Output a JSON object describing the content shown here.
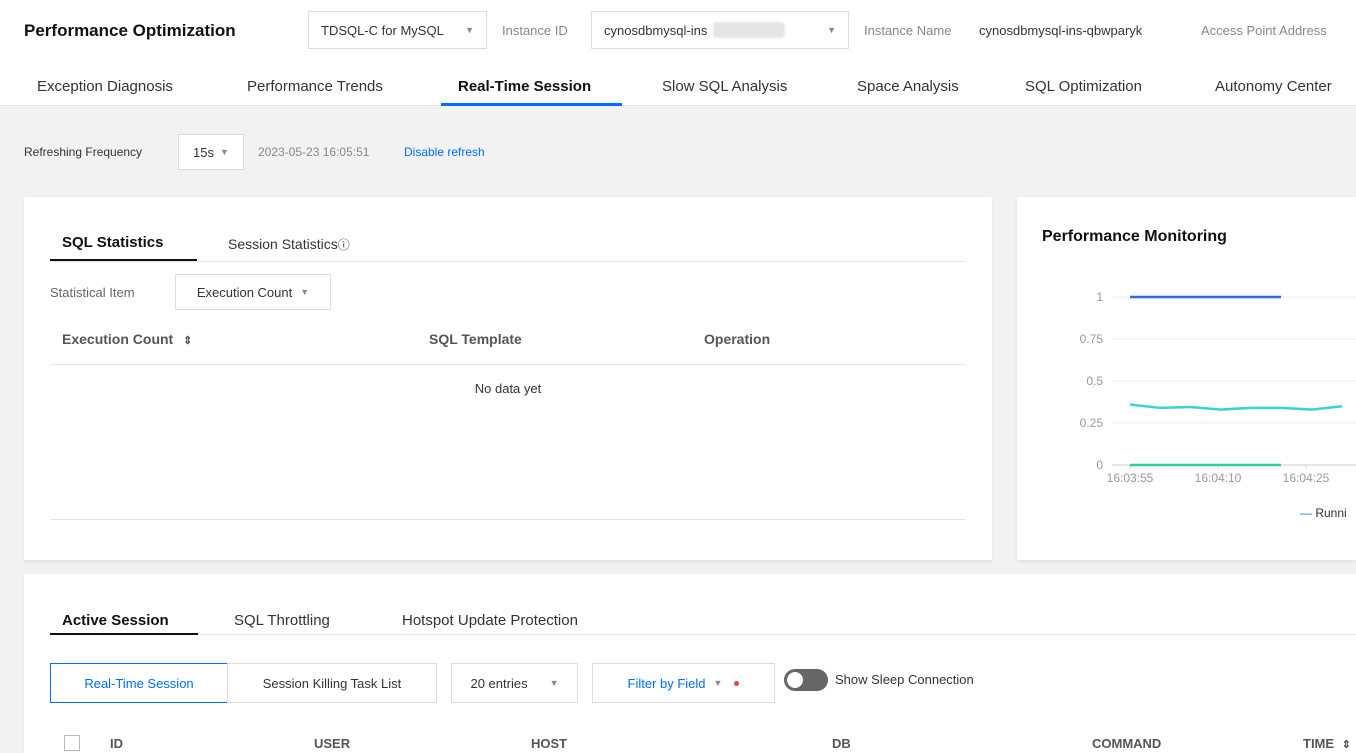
{
  "header": {
    "title": "Performance Optimization",
    "engine_select": "TDSQL-C for MySQL",
    "instance_id_label": "Instance ID",
    "instance_id_value": "cynosdbmysql-ins",
    "instance_name_label": "Instance Name",
    "instance_name_value": "cynosdbmysql-ins-qbwparyk",
    "access_point_label": "Access Point Address"
  },
  "tabs": [
    {
      "label": "Exception Diagnosis"
    },
    {
      "label": "Performance Trends"
    },
    {
      "label": "Real-Time Session"
    },
    {
      "label": "Slow SQL Analysis"
    },
    {
      "label": "Space Analysis"
    },
    {
      "label": "SQL Optimization"
    },
    {
      "label": "Autonomy Center"
    }
  ],
  "active_tab": "Real-Time Session",
  "refresh": {
    "label": "Refreshing Frequency",
    "frequency": "15s",
    "timestamp": "2023-05-23 16:05:51",
    "disable_link": "Disable refresh"
  },
  "sql_card": {
    "tabs": [
      "SQL Statistics",
      "Session Statistics"
    ],
    "info_icon": "info-circle-icon",
    "statistical_item_label": "Statistical Item",
    "statistical_item_value": "Execution Count",
    "columns": [
      "Execution Count",
      "SQL Template",
      "Operation"
    ],
    "empty_text": "No data yet"
  },
  "perf_card": {
    "title": "Performance Monitoring",
    "legend_label": "Runni"
  },
  "chart_data": {
    "type": "line",
    "x": [
      "16:03:55",
      "16:04:10",
      "16:04:25"
    ],
    "ylim": [
      0,
      1
    ],
    "yticks": [
      "0",
      "0.25",
      "0.5",
      "0.75",
      "1"
    ],
    "series": [
      {
        "color": "#2b6fd6",
        "values": [
          1,
          1,
          1
        ]
      },
      {
        "color": "#37d2dc",
        "values": [
          0.36,
          0.33,
          0.35
        ]
      },
      {
        "color": "#2fcf9b",
        "values": [
          0,
          0,
          0
        ]
      }
    ],
    "grid": true,
    "legend": "bottom-right"
  },
  "active_card": {
    "tabs": [
      "Active Session",
      "SQL Throttling",
      "Hotspot Update Protection"
    ],
    "buttons": {
      "realtime": "Real-Time Session",
      "killing": "Session Killing Task List",
      "entries": "20 entries",
      "filter": "Filter by Field"
    },
    "toggle_label": "Show Sleep Connection",
    "columns": [
      "ID",
      "USER",
      "HOST",
      "DB",
      "COMMAND",
      "TIME"
    ]
  }
}
